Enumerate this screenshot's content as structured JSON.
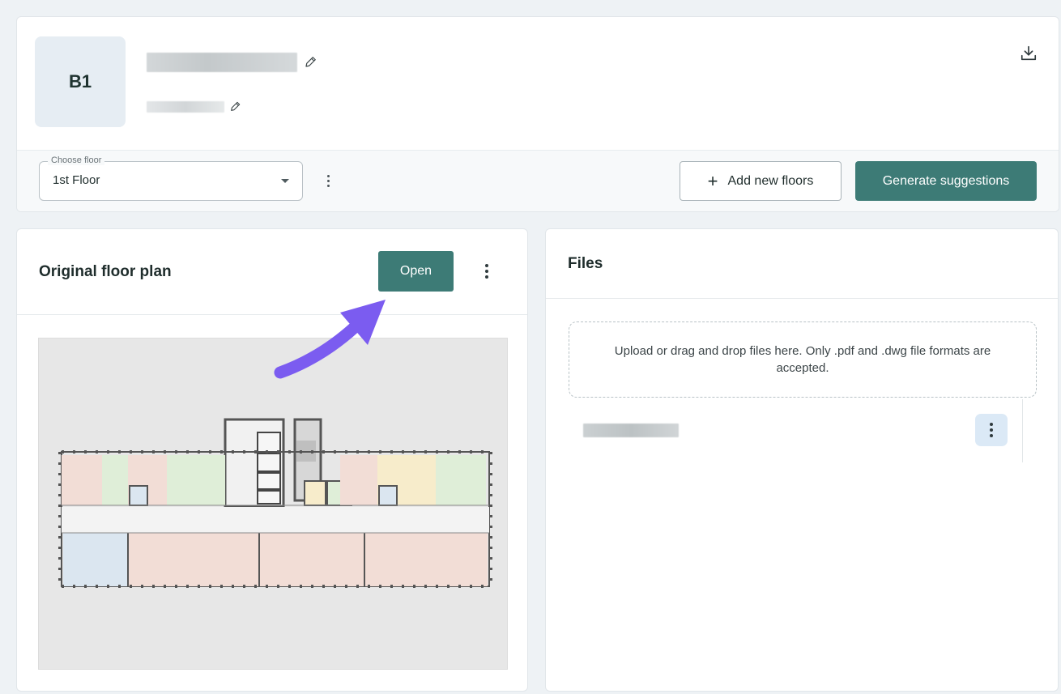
{
  "header": {
    "avatar_label": "B1",
    "choose_floor_label": "Choose floor",
    "selected_floor": "1st Floor",
    "add_floors_label": "Add new floors",
    "generate_label": "Generate suggestions"
  },
  "plan": {
    "title": "Original floor plan",
    "open_label": "Open"
  },
  "files": {
    "title": "Files",
    "dropzone_text": "Upload or drag and drop files here. Only .pdf and .dwg file formats are accepted."
  },
  "colors": {
    "primary": "#3d7b76",
    "page_bg": "#eef2f5",
    "arrow": "#7b5cf0",
    "room_pink": "#f2ddd6",
    "room_green": "#dfeed8",
    "room_yellow": "#f7eccb",
    "room_blue": "#dbe6f0"
  },
  "icons": {
    "edit": "pencil-icon",
    "download": "download-icon",
    "more": "more-vertical-icon"
  }
}
